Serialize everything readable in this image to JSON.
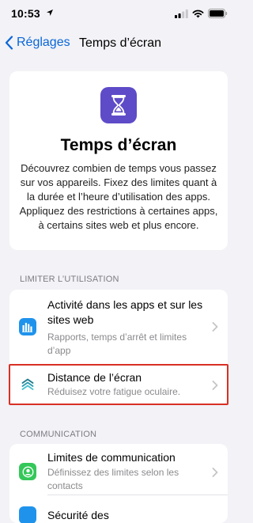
{
  "status_bar": {
    "time": "10:53",
    "icons": [
      "location-icon",
      "cellular-signal-icon",
      "wifi-icon",
      "battery-icon"
    ]
  },
  "nav": {
    "back_label": "Réglages",
    "title": "Temps d’écran"
  },
  "hero": {
    "icon": "hourglass-icon",
    "title": "Temps d’écran",
    "description": "Découvrez combien de temps vous passez sur vos appareils. Fixez des limites quant à la durée et l’heure d’utilisation des apps. Appliquez des restrictions à certaines apps, à certains sites web et plus encore."
  },
  "sections": {
    "limit": {
      "header": "LIMITER L’UTILISATION",
      "items": [
        {
          "title": "Activité dans les apps et sur les sites web",
          "subtitle": "Rapports, temps d’arrêt et limites d’app",
          "icon": "activity-chart-icon"
        },
        {
          "title": "Distance de l’écran",
          "subtitle": "Réduisez votre fatigue oculaire.",
          "icon": "screen-distance-icon"
        }
      ]
    },
    "communication": {
      "header": "COMMUNICATION",
      "items": [
        {
          "title": "Limites de communication",
          "subtitle": "Définissez des limites selon les contacts",
          "icon": "contact-icon"
        },
        {
          "title": "Sécurité des",
          "icon": "safety-icon"
        }
      ]
    }
  },
  "colors": {
    "accent": "#0a66d8",
    "app_icon": "#5e4bc8",
    "activity_icon": "#1f93ec",
    "contact_icon": "#34c759",
    "highlight": "#d93025",
    "background": "#f2f2f7"
  }
}
